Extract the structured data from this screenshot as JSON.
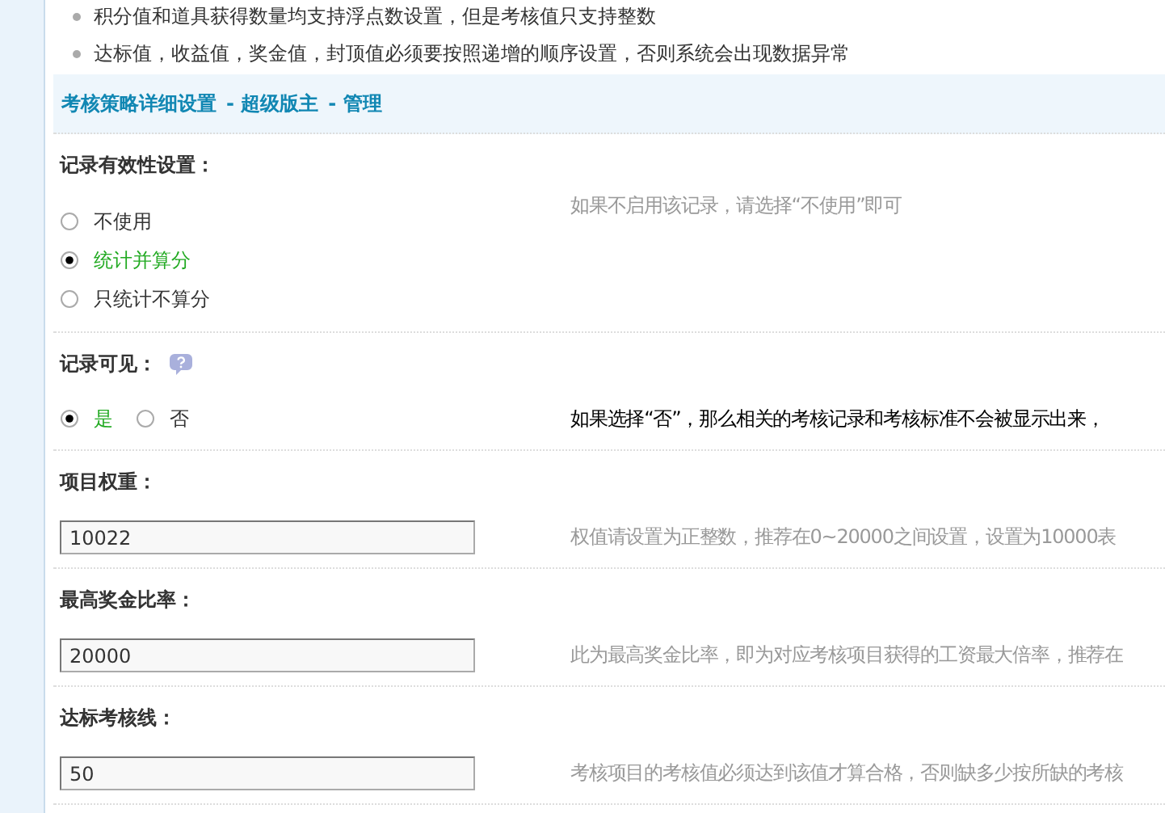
{
  "notes": [
    {
      "text": "积分值和道具获得数量均支持浮点数设置，但是考核值只支持整数"
    },
    {
      "text": "达标值，收益值，奖金值，封顶值必须要按照递增的顺序设置，否则系统会出现数据异常"
    }
  ],
  "section_header": {
    "title": "考核策略详细设置",
    "links": [
      "- 超级版主",
      "- 管理"
    ]
  },
  "settings": [
    {
      "kind": "radio_list",
      "label": "记录有效性设置：",
      "help_icon": false,
      "hint": "如果不启用该记录，请选择“不使用”即可",
      "hint_strong": false,
      "options": [
        {
          "label": "不使用",
          "selected": false
        },
        {
          "label": "统计并算分",
          "selected": true
        },
        {
          "label": "只统计不算分",
          "selected": false
        }
      ]
    },
    {
      "kind": "radio_inline",
      "label": "记录可见：",
      "help_icon": true,
      "hint": "如果选择“否”，那么相关的考核记录和考核标准不会被显示出来，",
      "hint_strong": true,
      "options": [
        {
          "label": "是",
          "selected": true
        },
        {
          "label": "否",
          "selected": false
        }
      ]
    },
    {
      "kind": "text",
      "label": "项目权重：",
      "value": "10022",
      "hint": "权值请设置为正整数，推荐在0~20000之间设置，设置为10000表",
      "hint_strong": false
    },
    {
      "kind": "text",
      "label": "最高奖金比率：",
      "value": "20000",
      "hint": "此为最高奖金比率，即为对应考核项目获得的工资最大倍率，推荐在",
      "hint_strong": false
    },
    {
      "kind": "text",
      "label": "达标考核线：",
      "value": "50",
      "hint": "考核项目的考核值必须达到该值才算合格，否则缺多少按所缺的考核",
      "hint_strong": false
    }
  ]
}
